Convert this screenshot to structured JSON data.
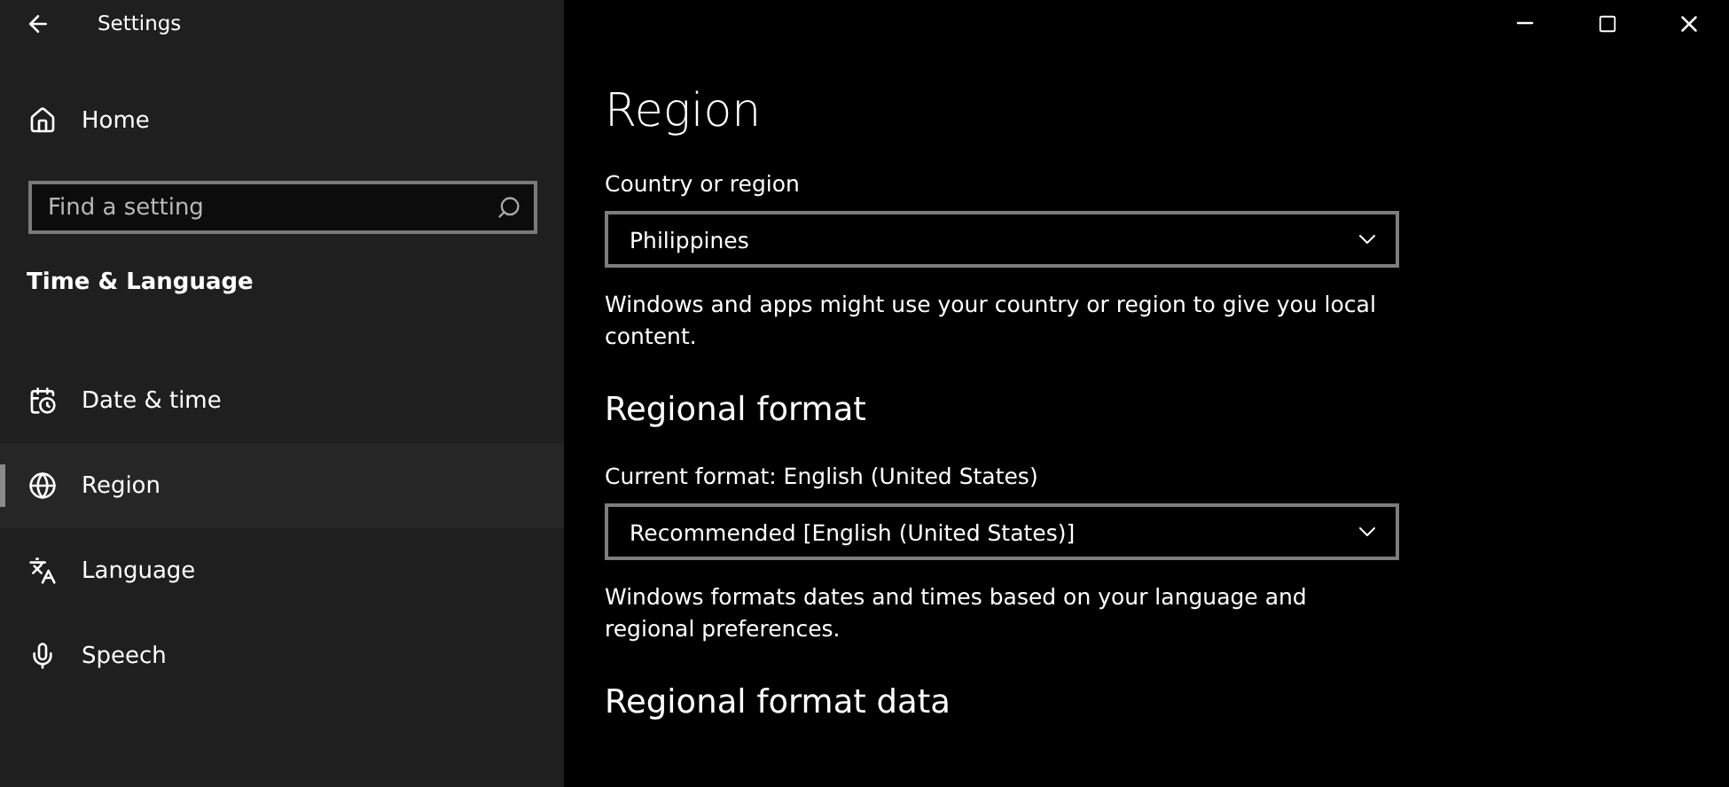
{
  "window": {
    "title": "Settings"
  },
  "sidebar": {
    "home": "Home",
    "search": {
      "placeholder": "Find a setting"
    },
    "section": "Time & Language",
    "items": [
      {
        "label": "Date & time",
        "selected": false
      },
      {
        "label": "Region",
        "selected": true
      },
      {
        "label": "Language",
        "selected": false
      },
      {
        "label": "Speech",
        "selected": false
      }
    ]
  },
  "page": {
    "title": "Region",
    "sections": [
      {
        "kind": "field",
        "label": "Country or region",
        "value": "Philippines",
        "description": "Windows and apps might use your country or region to give you local content."
      },
      {
        "kind": "heading",
        "text": "Regional format"
      },
      {
        "kind": "field",
        "label": "Current format: English (United States)",
        "value": "Recommended [English (United States)]",
        "description": "Windows formats dates and times based on your language and regional preferences."
      },
      {
        "kind": "heading",
        "text": "Regional format data"
      }
    ]
  }
}
